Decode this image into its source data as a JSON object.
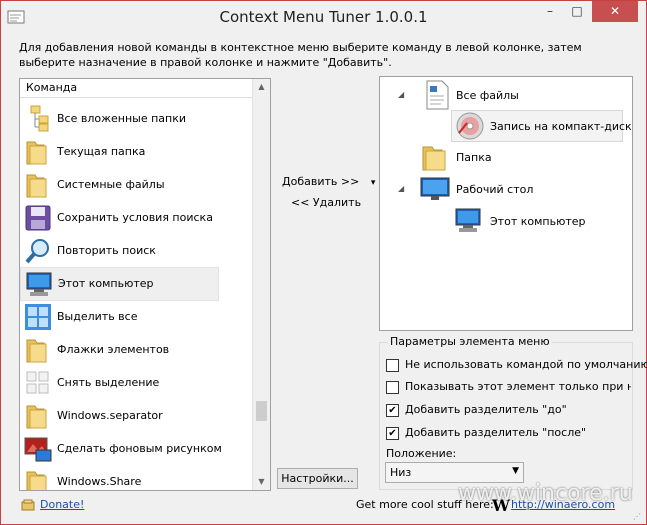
{
  "window": {
    "title": "Context Menu Tuner 1.0.0.1",
    "controls": {
      "minimize": "–",
      "maximize": "□",
      "close": "✕"
    },
    "close_color": "#c74f4f"
  },
  "description": "Для добавления новой команды в контекстное меню выберите команду в левой колонке, затем выберите назначение в правой колонке и нажмите \"Добавить\".",
  "commands": {
    "header": "Команда",
    "items": [
      {
        "label": "Все вложенные папки",
        "icon": "folder-tree-icon"
      },
      {
        "label": "Текущая папка",
        "icon": "folder-icon"
      },
      {
        "label": "Системные файлы",
        "icon": "folder-icon"
      },
      {
        "label": "Сохранить условия поиска",
        "icon": "floppy-icon"
      },
      {
        "label": "Повторить поиск",
        "icon": "magnifier-icon"
      },
      {
        "label": "Этот компьютер",
        "icon": "computer-icon"
      },
      {
        "label": "Выделить все",
        "icon": "select-all-icon"
      },
      {
        "label": "Флажки элементов",
        "icon": "folder-icon"
      },
      {
        "label": "Снять выделение",
        "icon": "deselect-icon"
      },
      {
        "label": "Windows.separator",
        "icon": "folder-icon"
      },
      {
        "label": "Сделать фоновым рисунком",
        "icon": "wallpaper-icon"
      },
      {
        "label": "Windows.Share",
        "icon": "folder-icon"
      }
    ],
    "selected_index": 5
  },
  "actions": {
    "add": "Добавить >>",
    "add_arrow": "▾",
    "remove": "<< Удалить",
    "settings": "Настройки..."
  },
  "targets": {
    "nodes": [
      {
        "label": "Все файлы",
        "icon": "file-icon",
        "expander": "◢"
      },
      {
        "label": "Запись на компакт-диск",
        "icon": "cd-icon"
      },
      {
        "label": "Папка",
        "icon": "folder-icon"
      },
      {
        "label": "Рабочий стол",
        "icon": "desktop-icon",
        "expander": "◢"
      },
      {
        "label": "Этот компьютер",
        "icon": "computer-icon"
      }
    ]
  },
  "params": {
    "title": "Параметры элемента меню",
    "checks": [
      {
        "label": "Не использовать командой по умолчанию",
        "checked": false
      },
      {
        "label": "Показывать этот элемент только при нажатии Shift",
        "checked": false
      },
      {
        "label": "Добавить разделитель \"до\"",
        "checked": true
      },
      {
        "label": "Добавить разделитель \"после\"",
        "checked": true
      }
    ],
    "position_label": "Положение:",
    "position_value": "Низ"
  },
  "footer": {
    "donate": "Donate!",
    "get_more": "Get more cool stuff here:",
    "logo": "W",
    "link": "http://winaero.com"
  },
  "watermark": "www.wincore.ru"
}
